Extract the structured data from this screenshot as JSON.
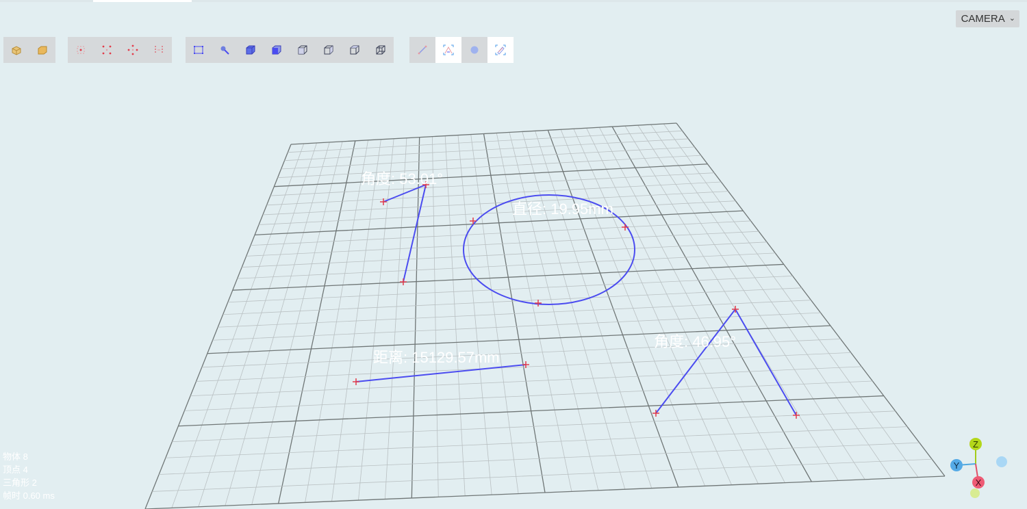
{
  "camera": {
    "label": "CAMERA"
  },
  "toolbar": {
    "groups": [
      {
        "name": "object-tools",
        "items": [
          {
            "name": "object-cube-icon",
            "active": false
          },
          {
            "name": "object-box-icon",
            "active": false
          }
        ]
      },
      {
        "name": "select-tools",
        "items": [
          {
            "name": "select-vertex-icon",
            "active": false
          },
          {
            "name": "select-points-icon",
            "active": false
          },
          {
            "name": "select-crosshair-icon",
            "active": false
          },
          {
            "name": "select-edges-icon",
            "active": false
          }
        ]
      },
      {
        "name": "view-tools",
        "items": [
          {
            "name": "frame-icon",
            "active": false
          },
          {
            "name": "pointer-icon",
            "active": false
          },
          {
            "name": "view-solid-cube-icon",
            "active": false
          },
          {
            "name": "view-front-cube-icon",
            "active": false
          },
          {
            "name": "view-wire-cube-icon",
            "active": false
          },
          {
            "name": "view-wire-cube-2-icon",
            "active": false
          },
          {
            "name": "view-wire-cube-3-icon",
            "active": false
          },
          {
            "name": "view-wire-cube-4-icon",
            "active": false
          }
        ]
      },
      {
        "name": "measure-tools",
        "items": [
          {
            "name": "measure-distance-icon",
            "active": false
          },
          {
            "name": "measure-angle-icon",
            "active": true
          },
          {
            "name": "measure-circle-icon",
            "active": false
          },
          {
            "name": "measure-area-icon",
            "active": true
          }
        ]
      }
    ]
  },
  "measurements": {
    "angle_1": "角度: 53.01°",
    "diameter": "直径: 19.95mm",
    "distance": "距离: 15129.57mm",
    "angle_2": "角度: 46.95°"
  },
  "stats": {
    "objects": "物体 8",
    "vertices": "顶点 4",
    "triangles": "三角形 2",
    "frame_time": "帧时 0.60 ms"
  },
  "axes": {
    "x": "X",
    "y": "Y",
    "z": "Z"
  },
  "colors": {
    "background": "#e2eef1",
    "measure_line": "#4b4cf0",
    "marker": "#e23b4a",
    "grid_major": "#6f7676",
    "grid_minor": "#b9c0c2"
  }
}
